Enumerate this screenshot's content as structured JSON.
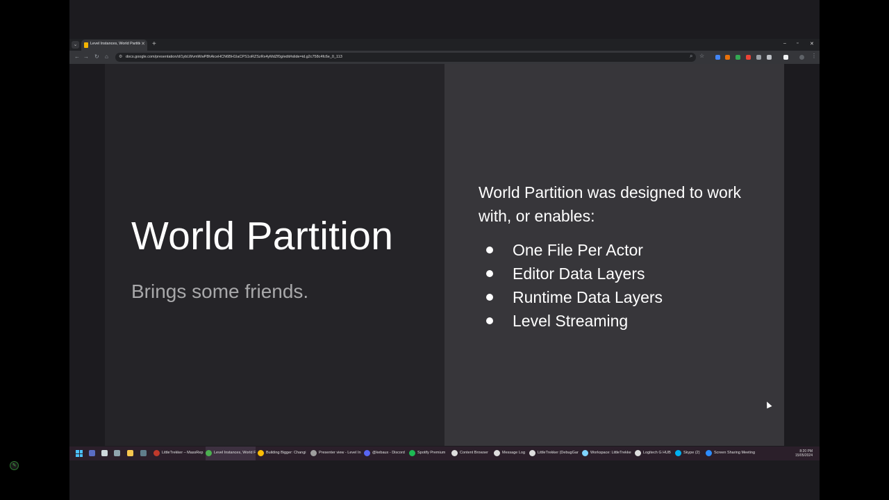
{
  "browser": {
    "tab_title": "Level Instances, World Partition",
    "tab_close": "✕",
    "new_tab": "+",
    "window_controls": [
      "–",
      "▫",
      "✕"
    ],
    "url": "docs.google.com/presentation/d/1ybLWvmWwP8hAiceHCN6BH1IaCPS1oRZSzRx4yMdZf0g/edit#slide=id.g2c758c4fc6e_0_113"
  },
  "slide": {
    "title": "World Partition",
    "subtitle": "Brings some friends.",
    "intro": "World Partition was designed to work with, or enables:",
    "bullets": [
      "One File Per Actor",
      "Editor Data Layers",
      "Runtime Data Layers",
      "Level Streaming"
    ]
  },
  "taskbar": {
    "apps": [
      {
        "label": "LittleTrekker – MassRep",
        "color": "#c0392b"
      },
      {
        "label": "Level Instances, World F",
        "color": "#4caf50"
      },
      {
        "label": "Building Bigger: Changi",
        "color": "#fbbc05"
      },
      {
        "label": "Presenter view - Level In",
        "color": "#9e9e9e"
      },
      {
        "label": "@kebaux - Discord",
        "color": "#5865f2"
      },
      {
        "label": "Spotify Premium",
        "color": "#1db954"
      },
      {
        "label": "Content Browser",
        "color": "#dddddd"
      },
      {
        "label": "Message Log",
        "color": "#dddddd"
      },
      {
        "label": "LittleTrekker (DebugGar",
        "color": "#dddddd"
      },
      {
        "label": "Workspace: LittleTrekke",
        "color": "#7fd3ff"
      },
      {
        "label": "Logitech G HUB",
        "color": "#dddddd"
      },
      {
        "label": "Skype (2)",
        "color": "#00aff0"
      },
      {
        "label": "Screen Sharing Meeting",
        "color": "#2d8cff"
      }
    ],
    "time": "8:20 PM",
    "date": "15/05/2024"
  }
}
